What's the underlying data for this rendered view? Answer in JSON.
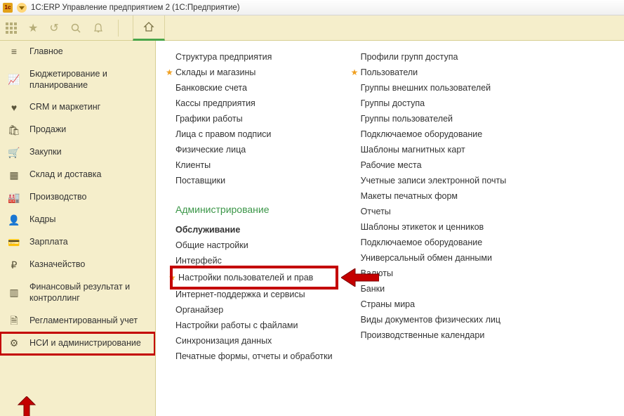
{
  "window": {
    "title": "1С:ERP Управление предприятием 2  (1С:Предприятие)"
  },
  "sidebar": {
    "items": [
      {
        "icon": "menu",
        "label": "Главное"
      },
      {
        "icon": "chart",
        "label": "Бюджетирование и планирование"
      },
      {
        "icon": "heart",
        "label": "CRM и маркетинг"
      },
      {
        "icon": "bag",
        "label": "Продажи"
      },
      {
        "icon": "cart",
        "label": "Закупки"
      },
      {
        "icon": "boxes",
        "label": "Склад и доставка"
      },
      {
        "icon": "factory",
        "label": "Производство"
      },
      {
        "icon": "person",
        "label": "Кадры"
      },
      {
        "icon": "card",
        "label": "Зарплата"
      },
      {
        "icon": "ruble",
        "label": "Казначейство"
      },
      {
        "icon": "bars",
        "label": "Финансовый результат и контроллинг"
      },
      {
        "icon": "doc",
        "label": "Регламентированный учет"
      },
      {
        "icon": "gear",
        "label": "НСИ и администрирование"
      }
    ]
  },
  "content": {
    "col1": [
      {
        "label": "Структура предприятия"
      },
      {
        "label": "Склады и магазины",
        "star": true
      },
      {
        "label": "Банковские счета"
      },
      {
        "label": "Кассы предприятия"
      },
      {
        "label": "Графики работы"
      },
      {
        "label": "Лица с правом подписи"
      },
      {
        "label": "Физические лица"
      },
      {
        "label": "Клиенты"
      },
      {
        "label": "Поставщики"
      }
    ],
    "section1_head": "Администрирование",
    "section1": [
      {
        "label": "Обслуживание",
        "strong": true
      },
      {
        "label": "Общие настройки"
      },
      {
        "label": "Интерфейс"
      },
      {
        "label": "Настройки пользователей и прав",
        "star": true,
        "boxed": true
      },
      {
        "label": "Интернет-поддержка и сервисы"
      },
      {
        "label": "Органайзер"
      },
      {
        "label": "Настройки работы с файлами"
      },
      {
        "label": "Синхронизация данных"
      },
      {
        "label": "Печатные формы, отчеты и обработки"
      }
    ],
    "col2": [
      {
        "label": "Профили групп доступа"
      },
      {
        "label": "Пользователи",
        "star": true
      },
      {
        "label": "Группы внешних пользователей"
      },
      {
        "label": "Группы доступа"
      },
      {
        "label": "Группы пользователей"
      },
      {
        "label": "Подключаемое оборудование"
      },
      {
        "label": "Шаблоны магнитных карт"
      },
      {
        "label": "Рабочие места"
      },
      {
        "label": "Учетные записи электронной почты"
      },
      {
        "label": "Макеты печатных форм"
      },
      {
        "label": "Отчеты"
      },
      {
        "label": "Шаблоны этикеток и ценников"
      },
      {
        "label": "Подключаемое оборудование"
      },
      {
        "label": "Универсальный обмен данными"
      },
      {
        "label": "Валюты"
      },
      {
        "label": "Банки"
      },
      {
        "label": "Страны мира"
      },
      {
        "label": "Виды документов физических лиц"
      },
      {
        "label": "Производственные календари"
      }
    ]
  }
}
